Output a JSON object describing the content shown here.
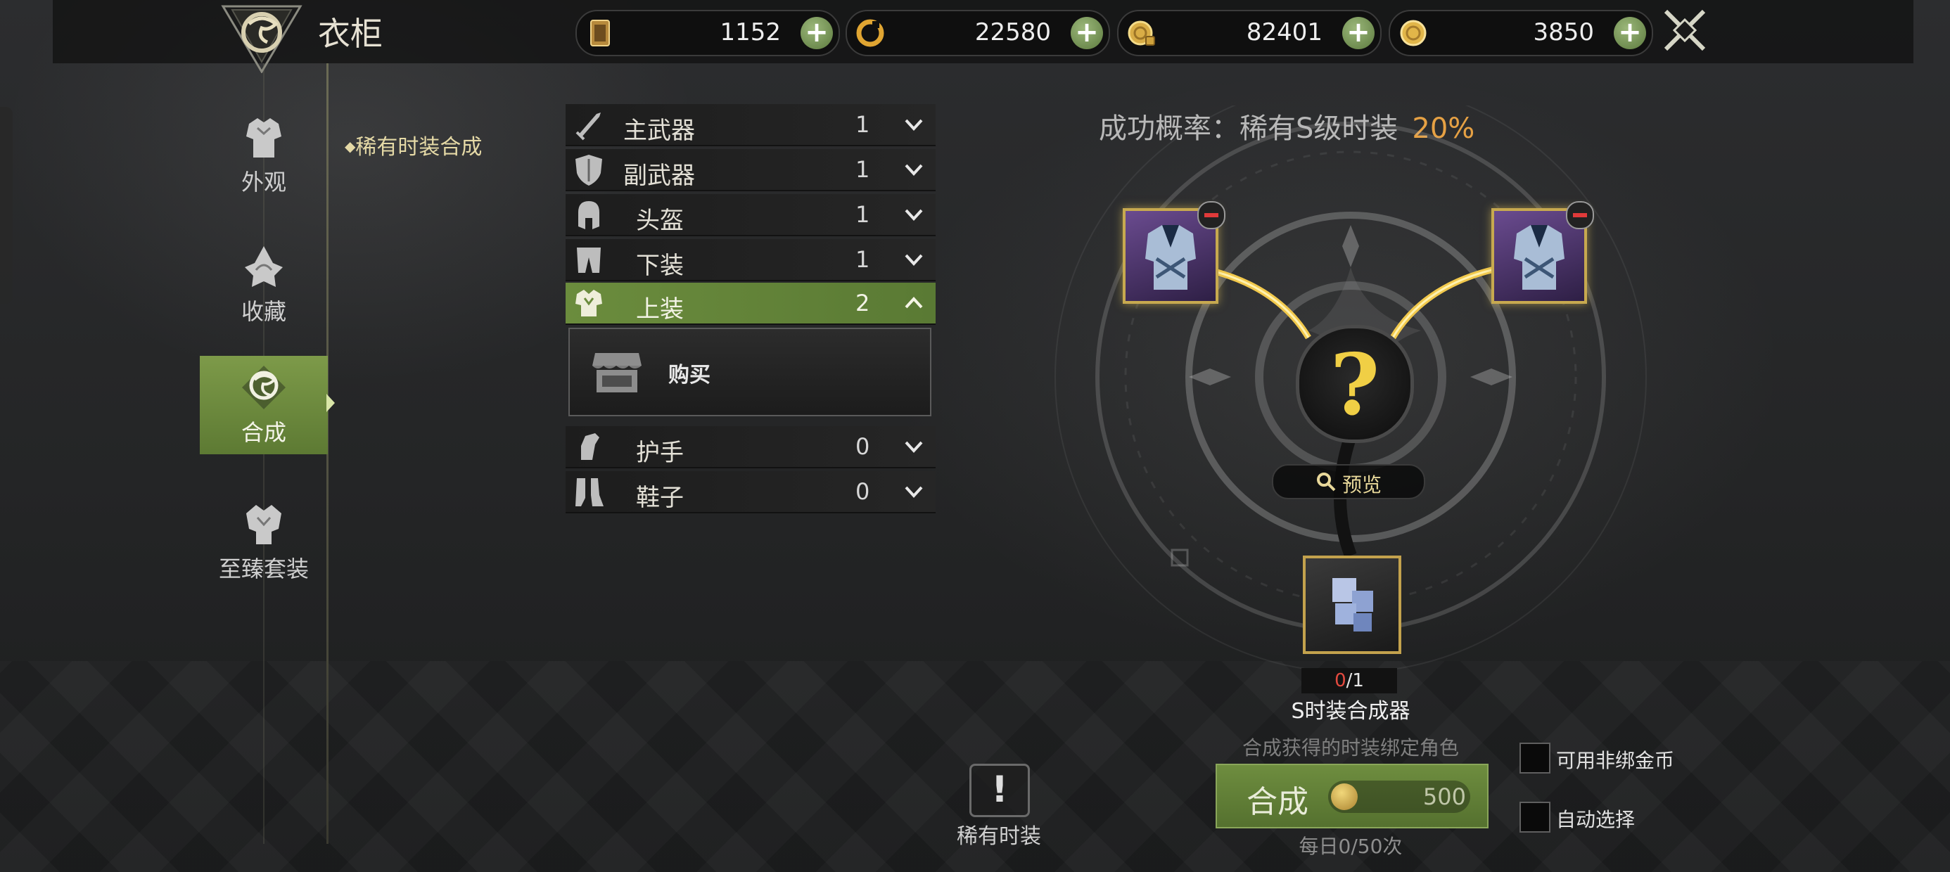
{
  "header": {
    "title": "衣柜",
    "currencies": [
      {
        "icon": "card-ticket-icon",
        "value": "1152"
      },
      {
        "icon": "cycle-token-icon",
        "value": "22580"
      },
      {
        "icon": "bound-gold-coin-icon",
        "value": "82401"
      },
      {
        "icon": "gold-coin-icon",
        "value": "3850"
      }
    ],
    "close_icon": "crossed-swords-close-icon"
  },
  "nav": {
    "items": [
      {
        "label": "外观",
        "icon": "armor-icon"
      },
      {
        "label": "收藏",
        "icon": "collection-icon"
      },
      {
        "label": "合成",
        "icon": "dragon-synthesis-icon",
        "active": true
      },
      {
        "label": "至臻套装",
        "icon": "premium-set-icon"
      }
    ],
    "subitem": "稀有时装合成"
  },
  "categories": [
    {
      "label": "主武器",
      "count": "1",
      "icon": "sword-icon",
      "expanded": false
    },
    {
      "label": "副武器",
      "count": "1",
      "icon": "shield-icon",
      "expanded": false
    },
    {
      "label": "头盔",
      "count": "1",
      "icon": "helmet-icon",
      "expanded": false
    },
    {
      "label": "下装",
      "count": "1",
      "icon": "pants-icon",
      "expanded": false
    },
    {
      "label": "上装",
      "count": "2",
      "icon": "chest-armor-icon",
      "expanded": true
    },
    {
      "label": "护手",
      "count": "0",
      "icon": "gauntlet-icon",
      "expanded": false
    },
    {
      "label": "鞋子",
      "count": "0",
      "icon": "boots-icon",
      "expanded": false
    }
  ],
  "buy": {
    "label": "购买",
    "icon": "shop-icon"
  },
  "synthesis": {
    "rate_label": "成功概率：稀有S级时装",
    "rate_value": "20%",
    "result_symbol": "?",
    "preview_label": "预览",
    "material_count_current": "0",
    "material_count_total": "/1",
    "material_name": "S时装合成器",
    "bind_note": "合成获得的时装绑定角色",
    "button_label": "合成",
    "cost": "500",
    "daily_limit": "每日0/50次",
    "option_nonbound": "可用非绑金币",
    "option_auto": "自动选择",
    "rare_costume_label": "稀有时装",
    "colors": {
      "accent_green": "#6b8c3d",
      "gold": "#c7a94f",
      "rate_orange": "#e6a144",
      "red": "#e34a3f"
    }
  }
}
